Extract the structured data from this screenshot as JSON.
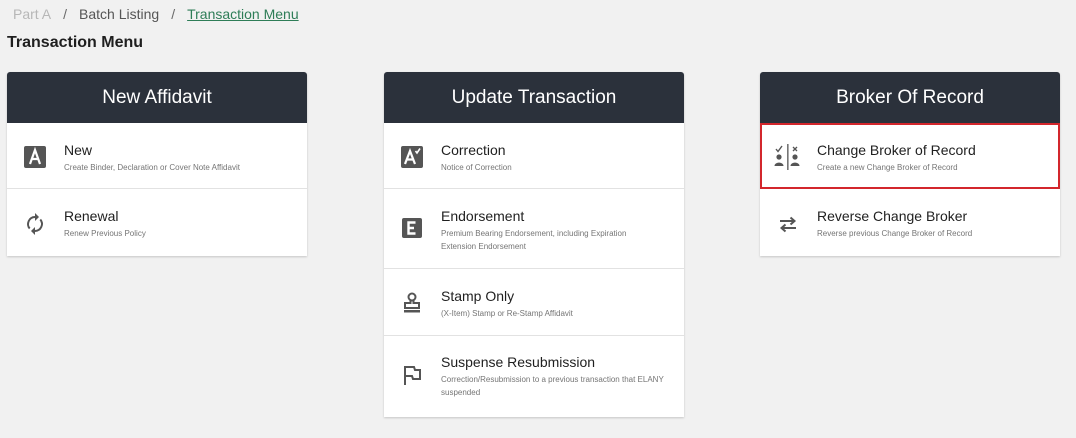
{
  "breadcrumb": {
    "part": "Part A",
    "batch": "Batch Listing",
    "current": "Transaction Menu",
    "separator": "/"
  },
  "page_title": "Transaction Menu",
  "cards": {
    "new_affidavit": {
      "header": "New Affidavit",
      "items": [
        {
          "title": "New",
          "desc": "Create Binder, Declaration or Cover Note Affidavit",
          "icon": "letter-a-icon"
        },
        {
          "title": "Renewal",
          "desc": "Renew Previous Policy",
          "icon": "refresh-icon"
        }
      ]
    },
    "update_transaction": {
      "header": "Update Transaction",
      "items": [
        {
          "title": "Correction",
          "desc": "Notice of Correction",
          "icon": "letter-a-check-icon"
        },
        {
          "title": "Endorsement",
          "desc": "Premium Bearing Endorsement, including Expiration Extension Endorsement",
          "icon": "letter-e-icon"
        },
        {
          "title": "Stamp Only",
          "desc": "(X-Item) Stamp or Re-Stamp Affidavit",
          "icon": "stamp-icon"
        },
        {
          "title": "Suspense Resubmission",
          "desc": "Correction/Resubmission to a previous transaction that ELANY suspended",
          "icon": "flag-icon"
        }
      ]
    },
    "broker_of_record": {
      "header": "Broker Of Record",
      "items": [
        {
          "title": "Change Broker of Record",
          "desc": "Create a new Change Broker of Record",
          "icon": "broker-swap-icon",
          "selected": true
        },
        {
          "title": "Reverse Change Broker",
          "desc": "Reverse previous Change Broker of Record",
          "icon": "swap-arrows-icon"
        }
      ]
    }
  },
  "colors": {
    "header_bg": "#2b313b",
    "link_green": "#2e7d57",
    "selected_outline": "#d3262c",
    "icon_gray": "#555555"
  }
}
